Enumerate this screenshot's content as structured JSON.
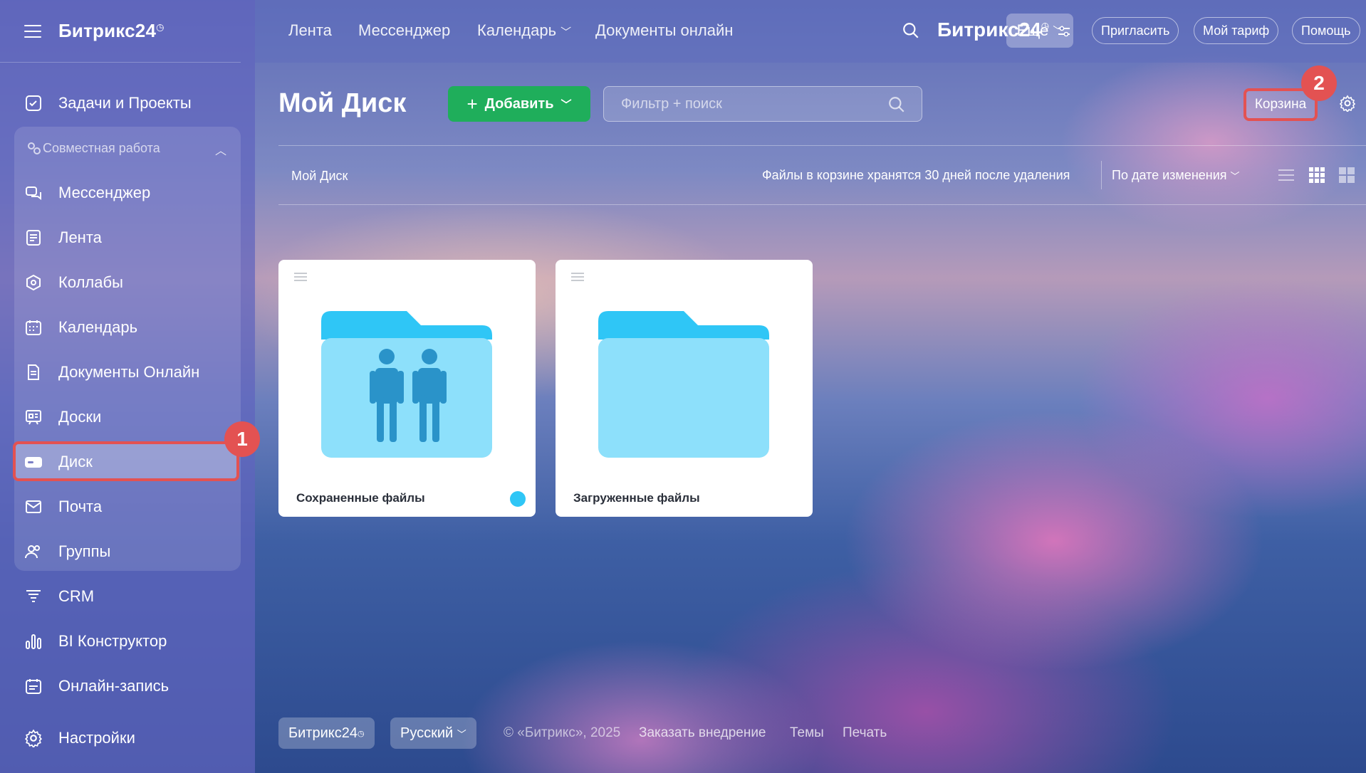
{
  "app": {
    "logo_text": "Битрикс24"
  },
  "sidebar": {
    "items": [
      {
        "label": "Задачи и Проекты"
      },
      {
        "label": "Мессенджер"
      },
      {
        "label": "Лента"
      },
      {
        "label": "Коллабы"
      },
      {
        "label": "Календарь"
      },
      {
        "label": "Документы Онлайн"
      },
      {
        "label": "Доски"
      },
      {
        "label": "Диск"
      },
      {
        "label": "Почта"
      },
      {
        "label": "Группы"
      },
      {
        "label": "CRM"
      },
      {
        "label": "BI Конструктор"
      },
      {
        "label": "Онлайн-запись"
      },
      {
        "label": "Настройки"
      }
    ],
    "group_title": "Совместная работа",
    "annotation_1": "1"
  },
  "topnav": {
    "links": [
      "Лента",
      "Мессенджер",
      "Календарь",
      "Документы онлайн"
    ],
    "more": "Еще",
    "brand": "Битрикс24",
    "invite": "Пригласить",
    "tariff": "Мой тариф",
    "help": "Помощь"
  },
  "main": {
    "title": "Мой Диск",
    "add_label": "Добавить",
    "search_placeholder": "Фильтр + поиск",
    "trash_label": "Корзина",
    "annotation_2": "2",
    "breadcrumb": "Мой Диск",
    "trash_note": "Файлы в корзине хранятся 30 дней после удаления",
    "sort_label": "По дате изменения",
    "folders": [
      {
        "name": "Сохраненные файлы"
      },
      {
        "name": "Загруженные файлы"
      }
    ]
  },
  "footer": {
    "brand": "Битрикс24",
    "language": "Русский",
    "copyright": "© «Битрикс», 2025",
    "order": "Заказать внедрение",
    "themes": "Темы",
    "print": "Печать"
  }
}
